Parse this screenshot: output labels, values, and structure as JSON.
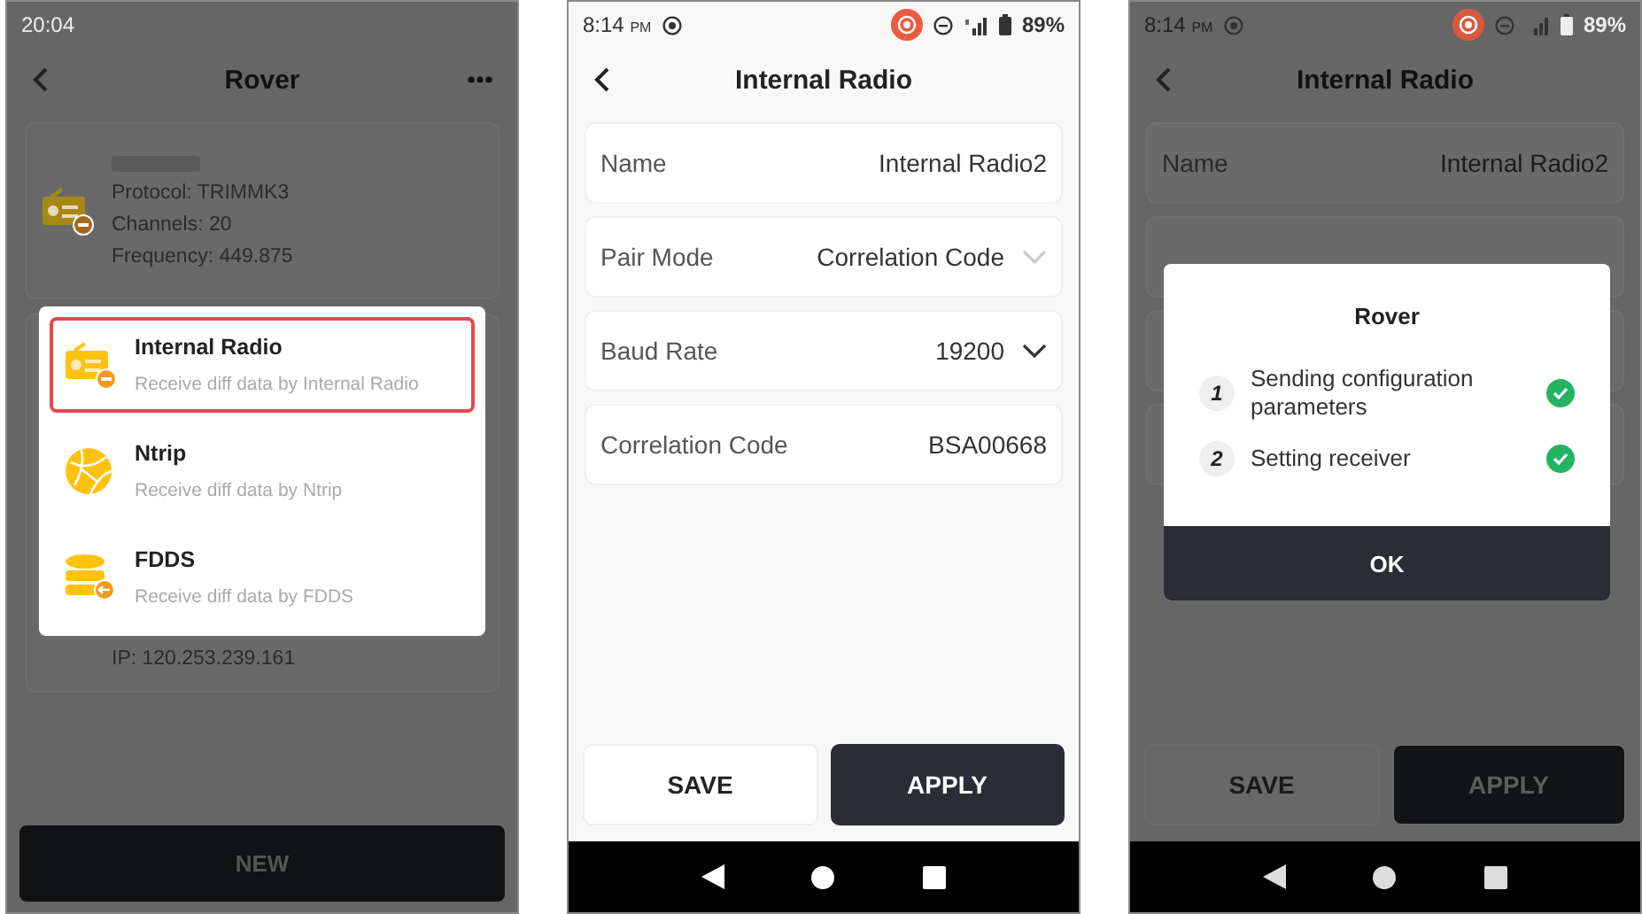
{
  "screens": [
    {
      "kind": "rover",
      "status_bar": {
        "time": "20:04"
      },
      "header": {
        "title": "Rover"
      },
      "device_card": {
        "lines": [
          "Protocol: TRIMMK3",
          "Channels: 20",
          "Frequency: 449.875"
        ]
      },
      "second_card": {
        "lines": [
          "IP: 120.253.239.161"
        ]
      },
      "menu": {
        "items": [
          {
            "kind": "radio",
            "title": "Internal Radio",
            "subtitle": "Receive diff data by Internal Radio",
            "selected": true
          },
          {
            "kind": "globe",
            "title": "Ntrip",
            "subtitle": "Receive diff data by Ntrip",
            "selected": false
          },
          {
            "kind": "database",
            "title": "FDDS",
            "subtitle": "Receive diff data by FDDS",
            "selected": false
          }
        ]
      },
      "primary_button": "NEW"
    },
    {
      "kind": "form",
      "dimmed": false,
      "status_bar": {
        "time": "8:14",
        "meridiem": "PM",
        "battery": "89%"
      },
      "header": {
        "title": "Internal Radio"
      },
      "fields": [
        {
          "kind": "text",
          "label": "Name",
          "value": "Internal Radio2"
        },
        {
          "kind": "select",
          "label": "Pair Mode",
          "value": "Correlation Code",
          "disabled": true
        },
        {
          "kind": "select",
          "label": "Baud Rate",
          "value": "19200",
          "disabled": false
        },
        {
          "kind": "text",
          "label": "Correlation Code",
          "value": "BSA00668"
        }
      ],
      "buttons": {
        "save": "SAVE",
        "apply": "APPLY"
      }
    },
    {
      "kind": "form",
      "dimmed": true,
      "status_bar": {
        "time": "8:14",
        "meridiem": "PM",
        "battery": "89%"
      },
      "header": {
        "title": "Internal Radio"
      },
      "fields": [
        {
          "kind": "text",
          "label": "Name",
          "value": "Internal Radio2"
        }
      ],
      "buttons": {
        "save": "SAVE",
        "apply": "APPLY"
      },
      "dialog": {
        "title": "Rover",
        "steps": [
          {
            "number": "1",
            "text": "Sending configuration parameters",
            "done": true
          },
          {
            "number": "2",
            "text": "Setting receiver",
            "done": true
          }
        ],
        "button": "OK"
      }
    }
  ]
}
